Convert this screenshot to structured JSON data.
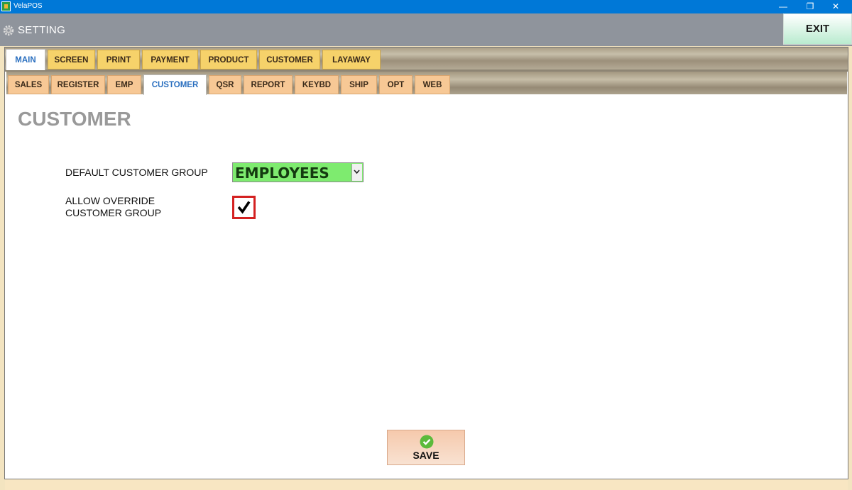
{
  "window": {
    "app_title": "VelaPOS",
    "minimize_glyph": "—",
    "maximize_glyph": "❐",
    "close_glyph": "✕"
  },
  "header": {
    "title": "SETTING",
    "icon": "gear-icon",
    "exit_label": "EXIT"
  },
  "main_tabs": [
    {
      "label": "MAIN",
      "active": true
    },
    {
      "label": "SCREEN",
      "active": false
    },
    {
      "label": "PRINT",
      "active": false
    },
    {
      "label": "PAYMENT",
      "active": false
    },
    {
      "label": "PRODUCT",
      "active": false
    },
    {
      "label": "CUSTOMER",
      "active": false
    },
    {
      "label": "LAYAWAY",
      "active": false
    }
  ],
  "sub_tabs": [
    {
      "label": "SALES",
      "active": false
    },
    {
      "label": "REGISTER",
      "active": false
    },
    {
      "label": "EMP",
      "active": false
    },
    {
      "label": "CUSTOMER",
      "active": true
    },
    {
      "label": "QSR",
      "active": false
    },
    {
      "label": "REPORT",
      "active": false
    },
    {
      "label": "KEYBD",
      "active": false
    },
    {
      "label": "SHIP",
      "active": false
    },
    {
      "label": "OPT",
      "active": false
    },
    {
      "label": "WEB",
      "active": false
    }
  ],
  "content": {
    "heading": "CUSTOMER",
    "default_group": {
      "label": "DEFAULT CUSTOMER GROUP",
      "value": "EMPLOYEES"
    },
    "allow_override": {
      "label_line1": "ALLOW OVERRIDE",
      "label_line2": "CUSTOMER GROUP",
      "checked": true
    },
    "save_label": "SAVE"
  },
  "colors": {
    "title_bar": "#0078d7",
    "header": "#8f949c",
    "main_tab": "#f6d26a",
    "sub_tab": "#f7c895",
    "select_bg": "#7eeb6f",
    "checkbox_border": "#d42121",
    "save_icon": "#5cba3b"
  }
}
